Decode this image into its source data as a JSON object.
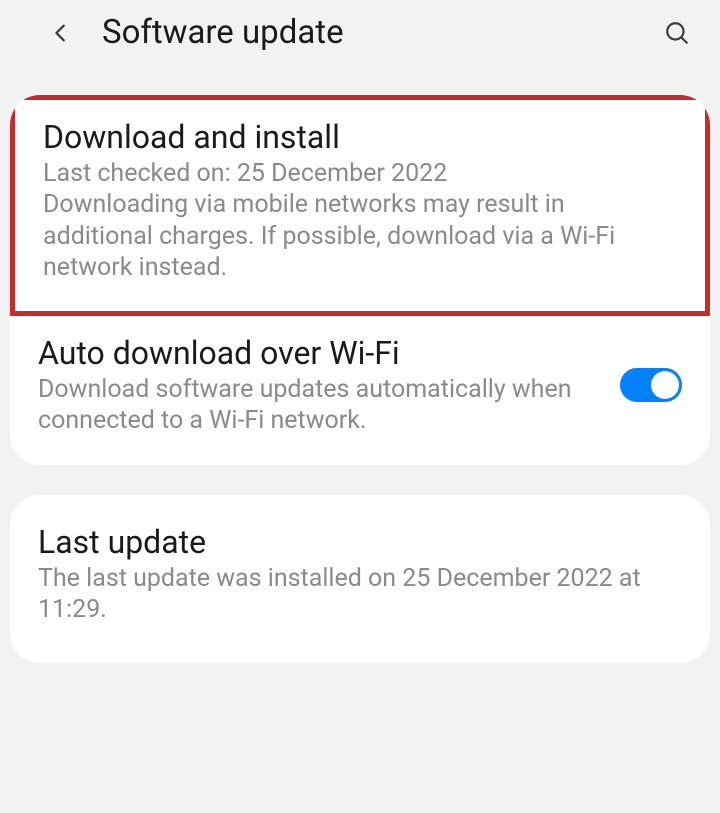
{
  "header": {
    "title": "Software update"
  },
  "items": {
    "download": {
      "title": "Download and install",
      "subtitle": "Last checked on: 25 December 2022\nDownloading via mobile networks may result in additional charges. If possible, download via a Wi-Fi network instead."
    },
    "auto": {
      "title": "Auto download over Wi-Fi",
      "subtitle": "Download software updates automatically when connected to a Wi-Fi network.",
      "toggle": true
    },
    "last": {
      "title": "Last update",
      "subtitle": "The last update was installed on 25 December 2022 at 11:29."
    }
  }
}
